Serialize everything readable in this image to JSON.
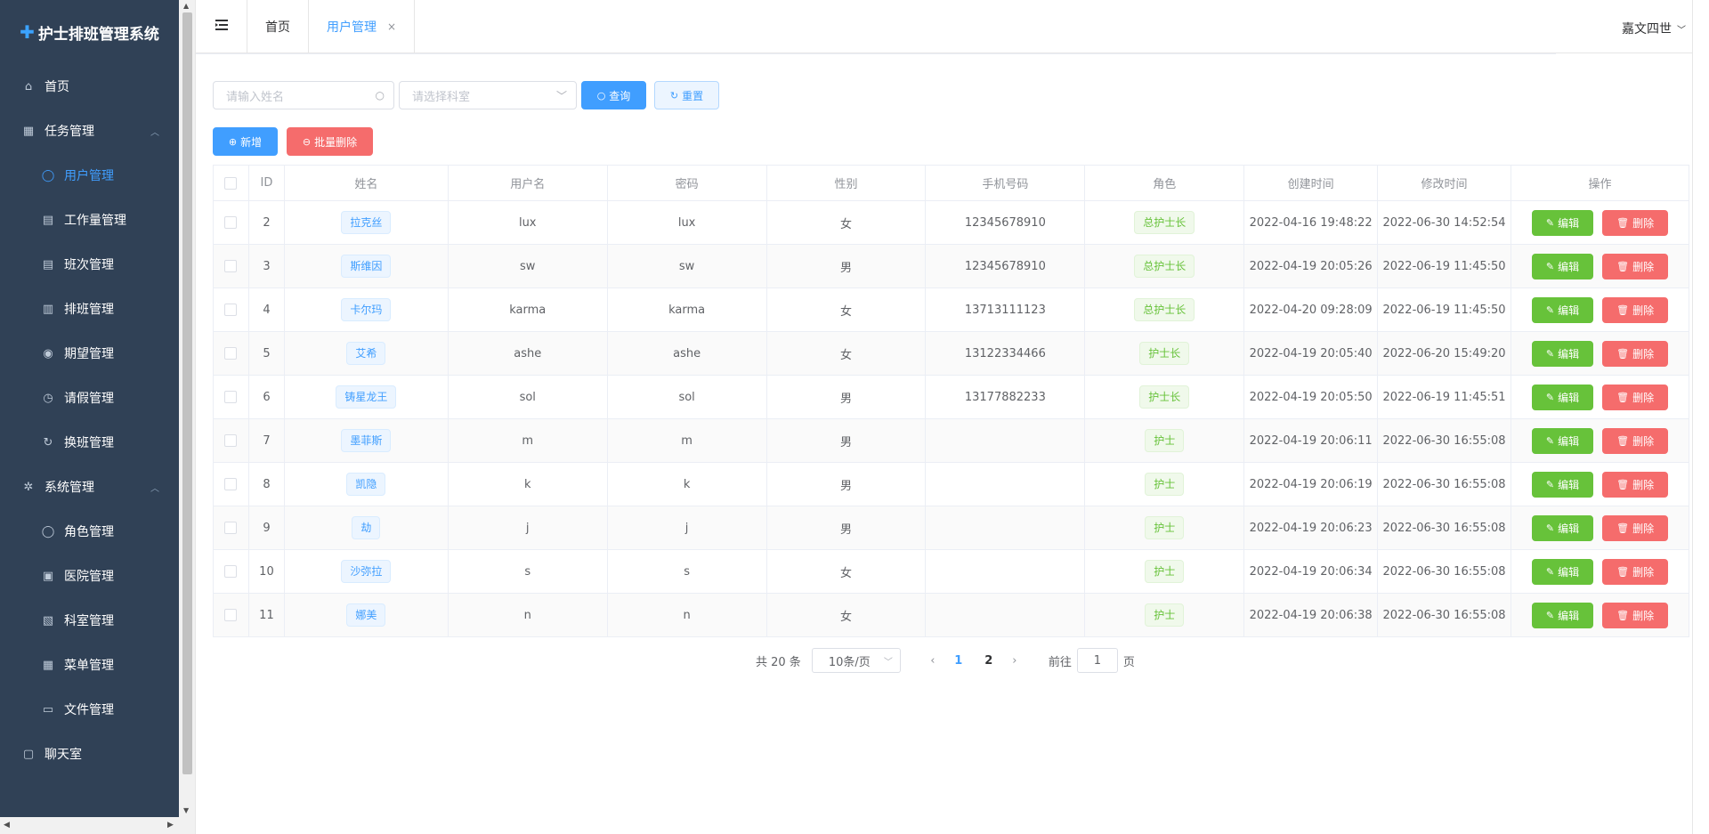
{
  "app": {
    "title": "护士排班管理系统"
  },
  "sidebar": {
    "items": [
      {
        "label": "首页",
        "icon": "home-icon",
        "level": "top"
      },
      {
        "label": "任务管理",
        "icon": "grid-icon",
        "level": "top",
        "expanded": true
      },
      {
        "label": "用户管理",
        "icon": "user-icon",
        "level": "sub",
        "active": true
      },
      {
        "label": "工作量管理",
        "icon": "clipboard-icon",
        "level": "sub"
      },
      {
        "label": "班次管理",
        "icon": "clipboard-icon",
        "level": "sub"
      },
      {
        "label": "排班管理",
        "icon": "calendar-icon",
        "level": "sub"
      },
      {
        "label": "期望管理",
        "icon": "location-icon",
        "level": "sub"
      },
      {
        "label": "请假管理",
        "icon": "clock-icon",
        "level": "sub"
      },
      {
        "label": "换班管理",
        "icon": "refresh-icon",
        "level": "sub"
      },
      {
        "label": "系统管理",
        "icon": "gear-icon",
        "level": "top",
        "expanded": true
      },
      {
        "label": "角色管理",
        "icon": "user-icon",
        "level": "sub"
      },
      {
        "label": "医院管理",
        "icon": "building-icon",
        "level": "sub"
      },
      {
        "label": "科室管理",
        "icon": "office-icon",
        "level": "sub"
      },
      {
        "label": "菜单管理",
        "icon": "grid-icon",
        "level": "sub"
      },
      {
        "label": "文件管理",
        "icon": "folder-icon",
        "level": "sub"
      },
      {
        "label": "聊天室",
        "icon": "chat-icon",
        "level": "top"
      }
    ]
  },
  "header": {
    "tabs": [
      {
        "label": "首页",
        "active": false
      },
      {
        "label": "用户管理",
        "active": true,
        "close": "×"
      }
    ],
    "user_name": "嘉文四世"
  },
  "toolbar": {
    "name_placeholder": "请输入姓名",
    "dept_placeholder": "请选择科室",
    "query_label": "查询",
    "reset_label": "重置",
    "add_label": "新增",
    "batch_delete_label": "批量删除"
  },
  "table": {
    "headers": [
      "ID",
      "姓名",
      "用户名",
      "密码",
      "性别",
      "手机号码",
      "角色",
      "创建时间",
      "修改时间",
      "操作"
    ],
    "edit_label": "编辑",
    "delete_label": "删除",
    "rows": [
      {
        "id": "2",
        "name": "拉克丝",
        "username": "lux",
        "password": "lux",
        "gender": "女",
        "phone": "12345678910",
        "role": "总护士长",
        "created": "2022-04-16 19:48:22",
        "modified": "2022-06-30 14:52:54"
      },
      {
        "id": "3",
        "name": "斯维因",
        "username": "sw",
        "password": "sw",
        "gender": "男",
        "phone": "12345678910",
        "role": "总护士长",
        "created": "2022-04-19 20:05:26",
        "modified": "2022-06-19 11:45:50"
      },
      {
        "id": "4",
        "name": "卡尔玛",
        "username": "karma",
        "password": "karma",
        "gender": "女",
        "phone": "13713111123",
        "role": "总护士长",
        "created": "2022-04-20 09:28:09",
        "modified": "2022-06-19 11:45:50"
      },
      {
        "id": "5",
        "name": "艾希",
        "username": "ashe",
        "password": "ashe",
        "gender": "女",
        "phone": "13122334466",
        "role": "护士长",
        "created": "2022-04-19 20:05:40",
        "modified": "2022-06-20 15:49:20"
      },
      {
        "id": "6",
        "name": "铸星龙王",
        "username": "sol",
        "password": "sol",
        "gender": "男",
        "phone": "13177882233",
        "role": "护士长",
        "created": "2022-04-19 20:05:50",
        "modified": "2022-06-19 11:45:51"
      },
      {
        "id": "7",
        "name": "墨菲斯",
        "username": "m",
        "password": "m",
        "gender": "男",
        "phone": "",
        "role": "护士",
        "created": "2022-04-19 20:06:11",
        "modified": "2022-06-30 16:55:08"
      },
      {
        "id": "8",
        "name": "凯隐",
        "username": "k",
        "password": "k",
        "gender": "男",
        "phone": "",
        "role": "护士",
        "created": "2022-04-19 20:06:19",
        "modified": "2022-06-30 16:55:08"
      },
      {
        "id": "9",
        "name": "劫",
        "username": "j",
        "password": "j",
        "gender": "男",
        "phone": "",
        "role": "护士",
        "created": "2022-04-19 20:06:23",
        "modified": "2022-06-30 16:55:08"
      },
      {
        "id": "10",
        "name": "沙弥拉",
        "username": "s",
        "password": "s",
        "gender": "女",
        "phone": "",
        "role": "护士",
        "created": "2022-04-19 20:06:34",
        "modified": "2022-06-30 16:55:08"
      },
      {
        "id": "11",
        "name": "娜美",
        "username": "n",
        "password": "n",
        "gender": "女",
        "phone": "",
        "role": "护士",
        "created": "2022-04-19 20:06:38",
        "modified": "2022-06-30 16:55:08"
      }
    ]
  },
  "pagination": {
    "total_text": "共 20 条",
    "page_size": "10条/页",
    "pages": [
      "1",
      "2"
    ],
    "current": "1",
    "goto_prefix": "前往",
    "goto_value": "1",
    "goto_suffix": "页"
  },
  "colors": {
    "sidebar_bg": "#304156",
    "primary": "#409eff",
    "success": "#67c23a",
    "danger": "#f56c6c"
  }
}
